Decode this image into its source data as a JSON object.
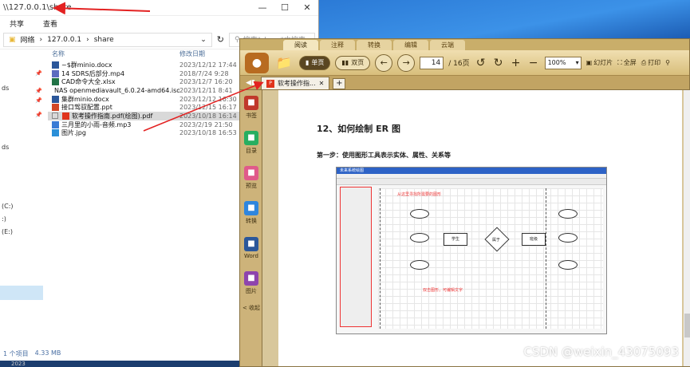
{
  "explorer": {
    "title": "\\\\127.0.0.1\\share",
    "ribbon": [
      "共享",
      "查看"
    ],
    "breadcrumb": [
      "网络",
      "127.0.0.1",
      "share"
    ],
    "search_placeholder": "搜索\"share\"中搜索",
    "nav_items": [
      "ds",
      "ds",
      "(C:)",
      ":)",
      "(E:)"
    ],
    "columns": {
      "name": "名称",
      "date": "修改日期"
    },
    "files": [
      {
        "name": "~$群minio.docx",
        "date": "2023/12/12 17:44",
        "icon": "word-icon",
        "color": "#2b579a"
      },
      {
        "name": "14 SDRS后部分.mp4",
        "date": "2018/7/24 9:28",
        "icon": "video-icon",
        "color": "#5c6bc0"
      },
      {
        "name": "CAD命令大全.xlsx",
        "date": "2023/12/7 16:20",
        "icon": "excel-icon",
        "color": "#217346"
      },
      {
        "name": "NAS openmediavault_6.0.24-amd64.iso",
        "date": "2023/12/11 8:41",
        "icon": "disc-icon",
        "color": "#777777"
      },
      {
        "name": "集群minio.docx",
        "date": "2023/12/12 16:30",
        "icon": "word-icon",
        "color": "#2b579a"
      },
      {
        "name": "接口驾驭配置.ppt",
        "date": "2023/12/15 16:17",
        "icon": "ppt-icon",
        "color": "#d24726"
      },
      {
        "name": "软考操作指南.pdf(绘图).pdf",
        "date": "2023/10/18 16:14",
        "icon": "pdf-icon",
        "color": "#e0341c",
        "selected": true
      },
      {
        "name": "三月里的小雨-音频.mp3",
        "date": "2023/2/19 21:50",
        "icon": "audio-icon",
        "color": "#3a7bd5"
      },
      {
        "name": "图片.jpg",
        "date": "2023/10/18 16:53",
        "icon": "image-icon",
        "color": "#2a8fd8"
      }
    ],
    "status": {
      "count": "1 个项目",
      "size": "4.33 MB"
    },
    "taskbar_peek": "2023"
  },
  "reader": {
    "menu_tabs": [
      "阅读",
      "注释",
      "转换",
      "编辑",
      "云端"
    ],
    "view_single": "单页",
    "view_double": "双页",
    "page_current": "14",
    "page_total": "/ 16页",
    "zoom": "100%",
    "slideshow": "幻灯片",
    "fullscreen": "全屏",
    "print": "打印",
    "tab_title": "软考操作指...",
    "rail": [
      {
        "label": "书签",
        "icon": "bookmark-icon",
        "color": "#c0392b"
      },
      {
        "label": "目录",
        "icon": "list-icon",
        "color": "#27ae60"
      },
      {
        "label": "预览",
        "icon": "preview-icon",
        "color": "#e05a8a"
      },
      {
        "label": "转换",
        "icon": "convert-icon",
        "color": "#2e86de"
      },
      {
        "label": "Word",
        "icon": "word-icon",
        "color": "#2b579a"
      },
      {
        "label": "图片",
        "icon": "picture-icon",
        "color": "#8e44ad"
      }
    ],
    "rail_collapse": "< 收起",
    "doc": {
      "section_title": "12、如何绘制 ER 图",
      "step_one": "第一步：使用图形工具表示实体、属性、关系等",
      "inner_title": "未来系统绘图",
      "inner_note_palette": "从这里寻找所需要的图形",
      "inner_note_text": "双击图形，可编辑文字",
      "inner_entity_1": "学生",
      "inner_relation": "属于",
      "inner_entity_2": "班级"
    }
  },
  "watermark": "CSDN @weixin_43075093"
}
